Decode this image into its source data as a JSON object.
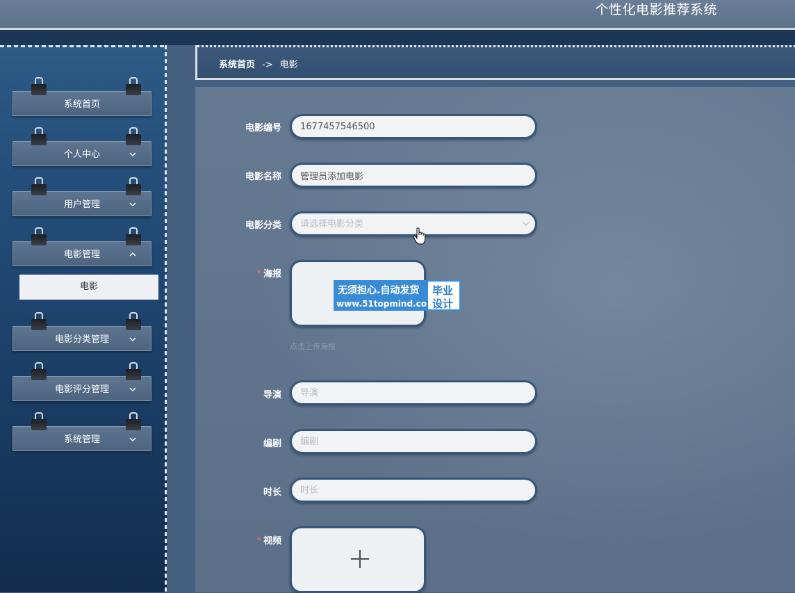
{
  "app": {
    "title": "个性化电影推荐系统"
  },
  "sidebar": {
    "items": [
      {
        "label": "系统首页",
        "has_chevron": false
      },
      {
        "label": "个人中心",
        "has_chevron": true,
        "expanded": false
      },
      {
        "label": "用户管理",
        "has_chevron": true,
        "expanded": false
      },
      {
        "label": "电影管理",
        "has_chevron": true,
        "expanded": true
      },
      {
        "label": "电影分类管理",
        "has_chevron": true,
        "expanded": false
      },
      {
        "label": "电影评分管理",
        "has_chevron": true,
        "expanded": false
      },
      {
        "label": "系统管理",
        "has_chevron": true,
        "expanded": false
      }
    ],
    "submenu": {
      "label": "电影"
    }
  },
  "breadcrumb": {
    "home": "系统首页",
    "separator": "->",
    "current": "电影"
  },
  "form": {
    "movie_no": {
      "label": "电影编号",
      "value": "1677457546500"
    },
    "movie_name": {
      "label": "电影名称",
      "value": "管理员添加电影"
    },
    "category": {
      "label": "电影分类",
      "placeholder": "请选择电影分类"
    },
    "poster": {
      "label": "海报",
      "required": true,
      "hint": "点击上传海报"
    },
    "director": {
      "label": "导演",
      "placeholder": "导演"
    },
    "writer": {
      "label": "编剧",
      "placeholder": "编剧"
    },
    "duration": {
      "label": "时长",
      "placeholder": "时长"
    },
    "video": {
      "label": "视频",
      "required": true
    }
  },
  "watermark": {
    "line1": "无须担心.自动发货",
    "line2": "www.51topmind.com",
    "badge_line1": "毕业",
    "badge_line2": "设计"
  },
  "icons": {
    "chevron_down": "chevron-down-icon",
    "chevron_up": "chevron-up-icon",
    "plus": "plus-icon",
    "pointer": "hand-pointer-icon"
  },
  "colors": {
    "sidebar_top": "#2d5a86",
    "sidebar_bottom": "#132c4d",
    "required_mark": "#f56c6c",
    "input_border": "#36567a",
    "watermark_blue": "#3a8bd6"
  }
}
